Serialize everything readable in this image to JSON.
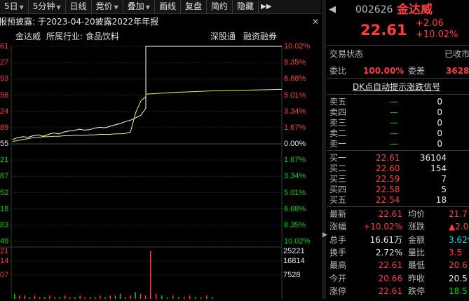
{
  "toolbar": {
    "items": [
      "5日",
      "5分钟",
      "日线",
      "竞价",
      "叠加",
      "画线",
      "复盘",
      "简约",
      "隐藏"
    ],
    "more": "▶▶"
  },
  "info": {
    "text": "年报预披露: 于2023-04-20披露2022年年报",
    "close": "✕"
  },
  "subheader": {
    "name": "金达威",
    "industry": "所属行业: 食品饮料",
    "tag1": "深股通",
    "tag2": "融资融券"
  },
  "chart_data": {
    "type": "line",
    "price_left_labels": [
      "22.61",
      "22.27",
      "21.93",
      "21.58",
      "21.24",
      "20.89",
      "20.55",
      "20.21",
      "19.87",
      "19.52",
      "19.18",
      "18.83",
      "18.49"
    ],
    "price_left_visible": [
      "61",
      "27",
      "93",
      "58",
      "24",
      "89",
      "55",
      "21",
      "87",
      "52",
      "18",
      "83",
      "49"
    ],
    "pct_labels": [
      "10.02%",
      "8.35%",
      "6.68%",
      "5.01%",
      "3.34%",
      "1.67%",
      "0.00%",
      "1.67%",
      "3.34%",
      "5.01%",
      "6.68%",
      "8.35%",
      "10.02%"
    ],
    "pct_colors": [
      "#ff3c3c",
      "#ff3c3c",
      "#ff3c3c",
      "#ff3c3c",
      "#ff3c3c",
      "#ff3c3c",
      "#e8e8e8",
      "#00d600",
      "#00d600",
      "#00d600",
      "#00d600",
      "#00d600",
      "#00d600"
    ],
    "volume_left_labels": [
      "21",
      "14",
      "07"
    ],
    "volume_right_labels": [
      "25221",
      "16814",
      "7528"
    ],
    "price_series": [
      20.64,
      20.68,
      20.7,
      20.69,
      20.72,
      20.74,
      20.71,
      20.75,
      20.78,
      20.76,
      20.8,
      20.82,
      20.83,
      20.86,
      20.84,
      20.85,
      20.88,
      20.9,
      20.89,
      20.92,
      20.95,
      20.98,
      21.02,
      21.05,
      21.1,
      21.15,
      21.3,
      22.61,
      22.61,
      22.61,
      22.61,
      22.61,
      22.61,
      22.61
    ],
    "avg_series": [
      20.6,
      20.62,
      20.64,
      20.66,
      20.68,
      20.69,
      20.7,
      20.7,
      20.71,
      20.71,
      20.72,
      20.72,
      20.73,
      20.73,
      20.73,
      20.74,
      20.74,
      20.75,
      20.75,
      20.75,
      20.76,
      20.76,
      20.77,
      20.8,
      21.2,
      21.45,
      21.55,
      21.6,
      21.63,
      21.65,
      21.67,
      21.68,
      21.69,
      21.7
    ],
    "volume_series": [
      3,
      2,
      2,
      1,
      2,
      1,
      1,
      2,
      1,
      1,
      2,
      1,
      1,
      2,
      1,
      1,
      1,
      2,
      1,
      2,
      2,
      3,
      1,
      2,
      4,
      3,
      2,
      28,
      8,
      3,
      2,
      1,
      2,
      1,
      1,
      2,
      1,
      1,
      2,
      1
    ],
    "ylim": [
      18.49,
      22.61
    ],
    "prev_close": 20.55
  },
  "quote": {
    "code": "002626",
    "name": "金达威",
    "price": "22.61",
    "change": "+2.06",
    "change_pct": "+10.02%",
    "state_label": "交易状态",
    "state_value": "已收市",
    "weibi_label": "委比",
    "weibi_value": "100.00%",
    "weicha_label": "委差",
    "weicha_value": "3628",
    "dk_label": "DK点自动提示涨跌信号"
  },
  "sells": [
    {
      "label": "卖五",
      "price": "—",
      "vol": "0"
    },
    {
      "label": "卖四",
      "price": "—",
      "vol": "0"
    },
    {
      "label": "卖三",
      "price": "—",
      "vol": "0"
    },
    {
      "label": "卖二",
      "price": "—",
      "vol": "0"
    },
    {
      "label": "卖一",
      "price": "—",
      "vol": "0"
    }
  ],
  "buys": [
    {
      "label": "买一",
      "price": "22.61",
      "vol": "36104"
    },
    {
      "label": "买二",
      "price": "22.60",
      "vol": "154"
    },
    {
      "label": "买三",
      "price": "22.59",
      "vol": "7"
    },
    {
      "label": "买四",
      "price": "22.58",
      "vol": "5"
    },
    {
      "label": "买五",
      "price": "22.54",
      "vol": "18"
    }
  ],
  "stats": [
    {
      "l1": "最新",
      "v1": "22.61",
      "c1": "red",
      "l2": "均价",
      "v2": "21.7",
      "c2": "red"
    },
    {
      "l1": "涨幅",
      "v1": "+10.02%",
      "c1": "red",
      "l2": "涨跌",
      "v2": "▲2.0",
      "c2": "red"
    },
    {
      "l1": "总手",
      "v1": "16.61万",
      "c1": "white",
      "l2": "金额",
      "v2": "3.62亿",
      "c2": "cyan"
    },
    {
      "l1": "换手",
      "v1": "2.72%",
      "c1": "white",
      "l2": "量比",
      "v2": "3.5",
      "c2": "red"
    },
    {
      "l1": "最高",
      "v1": "22.61",
      "c1": "red",
      "l2": "最低",
      "v2": "20.6",
      "c2": "red"
    },
    {
      "l1": "今开",
      "v1": "20.66",
      "c1": "red",
      "l2": "昨收",
      "v2": "20.5",
      "c2": "white"
    },
    {
      "l1": "涨停",
      "v1": "22.61",
      "c1": "red",
      "l2": "跌停",
      "v2": "18.5",
      "c2": "green"
    }
  ]
}
